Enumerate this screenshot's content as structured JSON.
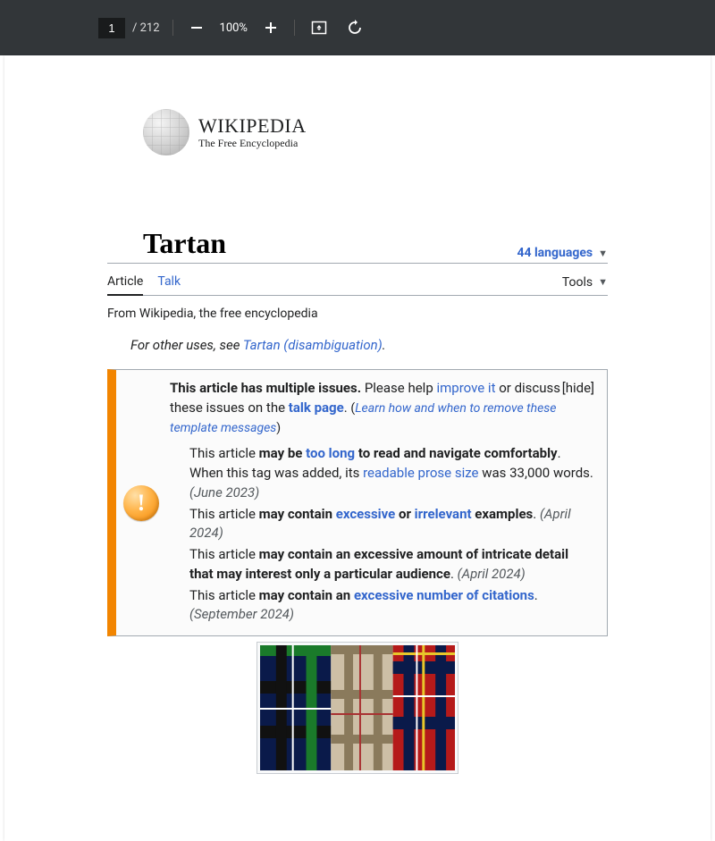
{
  "toolbar": {
    "current_page": "1",
    "page_count": "/ 212",
    "zoom": "100%"
  },
  "logo": {
    "wordmark": "WIKIPEDIA",
    "tagline": "The Free Encyclopedia"
  },
  "article": {
    "title": "Tartan",
    "languages": "44 languages",
    "tab_article": "Article",
    "tab_talk": "Talk",
    "tools": "Tools",
    "subtitle": "From Wikipedia, the free encyclopedia",
    "hatnote_prefix": "For other uses, see ",
    "hatnote_link": "Tartan (disambiguation)",
    "hatnote_suffix": "."
  },
  "ambox": {
    "lead_bold": "This article has multiple issues.",
    "lead_a": " Please help ",
    "improve": "improve it",
    "lead_b": " or discuss these issues on the ",
    "talk_page": "talk page",
    "lead_c": ". ",
    "learn_open": "(",
    "learn": "Learn how and when to remove these template messages",
    "learn_close": ")",
    "hide": "[hide]",
    "i1_a": "This article ",
    "i1_b": "may be ",
    "i1_link": "too long",
    "i1_c": " to read and navigate comfortably",
    "i1_d": ". When this tag was added, its ",
    "i1_link2": "readable prose size",
    "i1_e": " was 33,000 words. ",
    "i1_date": "(June 2023)",
    "i2_a": "This article ",
    "i2_b": "may contain ",
    "i2_link": "excessive",
    "i2_c": " or ",
    "i2_link2": "irrelevant",
    "i2_d": " examples",
    "i2_e": ". ",
    "i2_date": "(April 2024)",
    "i3_a": "This article ",
    "i3_b": "may contain an excessive amount of intricate detail that may interest only a particular audience",
    "i3_c": ". ",
    "i3_date": "(April 2024)",
    "i4_a": "This article ",
    "i4_b": "may contain an ",
    "i4_link": "excessive number of citations",
    "i4_c": ". ",
    "i4_date": "(September 2024)"
  }
}
